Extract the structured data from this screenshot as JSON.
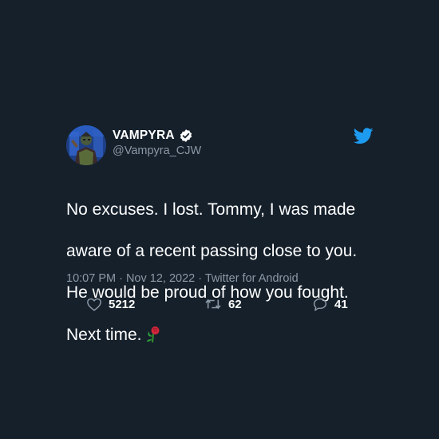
{
  "tweet": {
    "display_name": "VAMPYRA",
    "handle": "@Vampyra_CJW",
    "verified": true,
    "text_lines": [
      "No excuses. I lost. Tommy, I was made",
      "aware of a recent passing close to you.",
      "He would be proud of how you fought.",
      "Next time."
    ],
    "emoji": "rose-emoji",
    "meta": "10:07 PM · Nov 12, 2022 · Twitter for Android",
    "likes": "5212",
    "retweets": "62",
    "replies": "41"
  },
  "colors": {
    "background": "#15202b",
    "text": "#ffffff",
    "secondary_text": "#8b98a5",
    "brand_blue": "#1d9bf0"
  },
  "icons": {
    "logo": "twitter-bird-icon",
    "verified": "verified-badge-icon",
    "like": "heart-icon",
    "retweet": "retweet-icon",
    "reply": "reply-bubble-icon"
  }
}
